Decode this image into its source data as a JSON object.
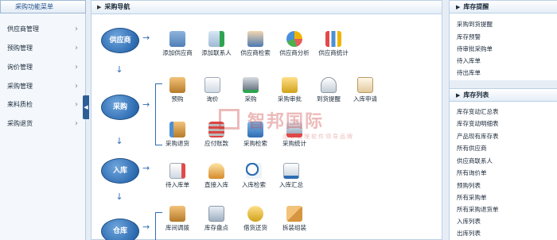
{
  "sidebar": {
    "title": "采购功能菜单",
    "items": [
      "供应商管理",
      "预购管理",
      "询价管理",
      "采购管理",
      "来料质检",
      "采购退货"
    ]
  },
  "main": {
    "title": "采购导航",
    "stages": [
      "供应商",
      "采购",
      "入库",
      "仓库"
    ],
    "supplier_items": [
      "添加供应商",
      "添加联系人",
      "供应商检索",
      "供应商分析",
      "供应商统计"
    ],
    "purchase_row1": [
      "预购",
      "询价",
      "采购",
      "采购审批",
      "到货提醒",
      "入库申请"
    ],
    "purchase_row2": [
      "采购退货",
      "应付账款",
      "采购检索",
      "采购统计"
    ],
    "stockin_items": [
      "待入库单",
      "直接入库",
      "入库检索",
      "入库汇总"
    ],
    "warehouse_items": [
      "库间调拨",
      "库存盘点",
      "借货还货",
      "拆装组装"
    ]
  },
  "watermark": {
    "big": "智邦国际",
    "small": "企业管理软件领导品牌"
  },
  "reminders": {
    "title": "库存提醒",
    "links": [
      "采购到货提醒",
      "库存预警",
      "待审批采购单",
      "待入库单",
      "待出库单"
    ]
  },
  "stock_list": {
    "title": "库存列表",
    "links": [
      "库存变动汇总表",
      "库存变动明细表",
      "产品现有库存表",
      "所有供应商",
      "供应商联系人",
      "所有询价单",
      "预购列表",
      "所有采购单",
      "所有采购退货单",
      "入库列表",
      "出库列表"
    ]
  },
  "colors": {
    "accent": "#2f6db3",
    "brand_red": "#cc3b3b"
  }
}
